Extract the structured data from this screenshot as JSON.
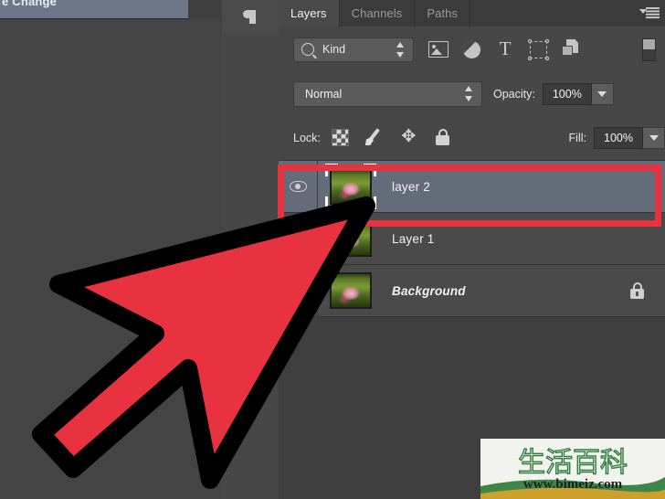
{
  "workspace": {
    "tooltip_text": "e Change"
  },
  "dock": {
    "paragraph_icon": "paragraph-icon"
  },
  "panel": {
    "tabs": [
      {
        "label": "Layers",
        "active": true
      },
      {
        "label": "Channels",
        "active": false
      },
      {
        "label": "Paths",
        "active": false
      }
    ],
    "menu_icon": "panel-menu-icon"
  },
  "filter": {
    "search_icon": "search-icon",
    "kind_label": "Kind",
    "stepper_icon": "stepper-arrows-icon",
    "icons": [
      "pixel-layer-filter-icon",
      "adjustment-layer-filter-icon",
      "type-layer-filter-icon",
      "shape-layer-filter-icon",
      "smart-object-filter-icon"
    ],
    "type_glyph": "T",
    "toggle_icon": "filter-enable-toggle"
  },
  "blend": {
    "mode": "Normal",
    "opacity_label": "Opacity:",
    "opacity_value": "100%",
    "dropdown_icon": "chevron-down-icon"
  },
  "lock": {
    "label": "Lock:",
    "icons": [
      "transparency-lock-icon",
      "paint-lock-icon",
      "position-lock-icon",
      "all-lock-icon"
    ],
    "move_glyph": "✥",
    "fill_label": "Fill:",
    "fill_value": "100%",
    "dropdown_icon": "chevron-down-icon"
  },
  "layers": [
    {
      "name": "layer 2",
      "visible": true,
      "selected": true,
      "italic": false,
      "locked": false,
      "thumbnail": "flower-thumbnail",
      "thumb_selected": true
    },
    {
      "name": "Layer 1",
      "visible": false,
      "selected": false,
      "italic": false,
      "locked": false,
      "thumbnail": "flower-thumbnail",
      "thumb_selected": false
    },
    {
      "name": "Background",
      "visible": true,
      "selected": false,
      "italic": true,
      "locked": true,
      "thumbnail": "flower-thumbnail",
      "thumb_selected": false
    }
  ],
  "annotation": {
    "cursor_icon": "red-arrow-cursor",
    "highlight_color": "#e8323f",
    "highlight_target": "layer-2-row"
  },
  "watermark": {
    "title": "生活百科",
    "url": "www.bimeiz.com"
  },
  "colors": {
    "panel_bg": "#474747",
    "list_bg": "#3f3f3f",
    "row_bg": "#4a4a4a",
    "row_selected_bg": "#636c78",
    "tab_active_bg": "#4a4a4a",
    "tab_bar_bg": "#3b3b3b",
    "accent_red": "#e8323f",
    "tooltip_blue": "#6c7888"
  }
}
